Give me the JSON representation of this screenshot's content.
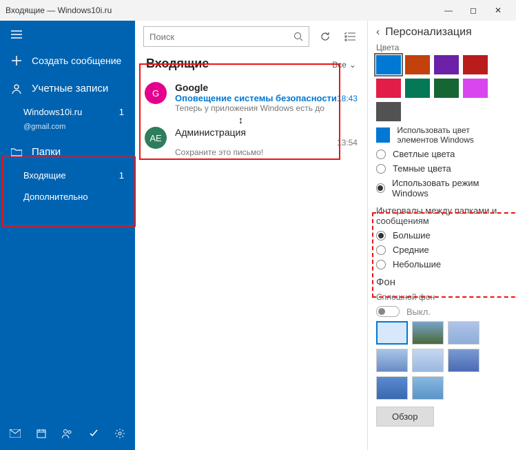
{
  "titlebar": {
    "title": "Входящие — Windows10i.ru"
  },
  "sidebar": {
    "compose": "Создать сообщение",
    "accounts_label": "Учетные записи",
    "account": {
      "name": "Windows10i.ru",
      "email": "@gmail.com",
      "unread": "1"
    },
    "folders_label": "Папки",
    "folders": [
      {
        "label": "Входящие",
        "count": "1"
      },
      {
        "label": "Дополнительно",
        "count": ""
      }
    ]
  },
  "mid": {
    "search_placeholder": "Поиск",
    "header": "Входящие",
    "filter": "Все",
    "messages": [
      {
        "avatar": "G",
        "avatar_bg": "#e3008c",
        "from": "Google",
        "subject": "Оповещение системы безопасности",
        "preview": "Теперь у приложения Windows есть до",
        "time": "18:43",
        "read": false
      },
      {
        "avatar": "АЕ",
        "avatar_bg": "#2e7d5b",
        "from": "Администрация",
        "subject": "",
        "preview": "Сохраните это письмо!",
        "time": "13:54",
        "read": true
      }
    ]
  },
  "pane": {
    "title": "Персонализация",
    "colors_label": "Цвета",
    "swatches": [
      "#0078d4",
      "#c2410c",
      "#6b21a8",
      "#b91c1c",
      "#e11d48",
      "#047857",
      "#166534",
      "#d946ef",
      "#525252"
    ],
    "use_accent": "Использовать цвет элементов Windows",
    "theme": [
      {
        "label": "Светлые цвета",
        "on": false
      },
      {
        "label": "Темные цвета",
        "on": false
      },
      {
        "label": "Использовать режим Windows",
        "on": true
      }
    ],
    "spacing_label": "Интервалы между папками и сообщениям",
    "spacing": [
      {
        "label": "Большие",
        "on": true
      },
      {
        "label": "Средние",
        "on": false
      },
      {
        "label": "Небольшие",
        "on": false
      }
    ],
    "bg_label": "Фон",
    "bg_sub": "Сплошной фон",
    "toggle_label": "Выкл.",
    "browse": "Обзор"
  }
}
